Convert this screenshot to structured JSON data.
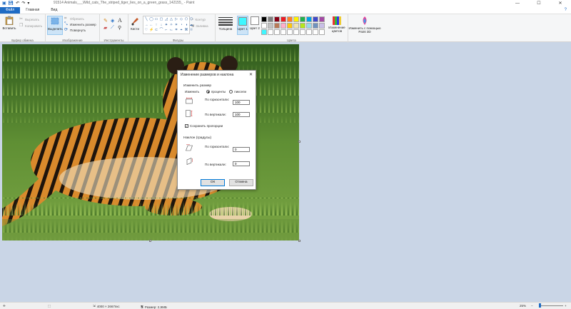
{
  "window": {
    "title": "91514 Animals___Wild_cats_The_striped_tiger_lies_on_a_green_grass_142155_ - Paint",
    "minimize": "—",
    "maximize": "☐",
    "close": "✕"
  },
  "quick_access": [
    "save-icon",
    "undo-icon",
    "redo-icon",
    "dropdown-icon"
  ],
  "tabs": [
    "Файл",
    "Главная",
    "Вид"
  ],
  "help_glyph": "?",
  "ribbon": {
    "clipboard": {
      "paste": "Вставить",
      "cut": "Вырезать",
      "copy": "Копировать",
      "label": "Буфер обмена"
    },
    "image": {
      "select": "Выделить",
      "crop": "Обрезать",
      "resize": "Изменить размер",
      "rotate": "Повернуть",
      "label": "Изображение"
    },
    "tools": {
      "label": "Инструменты",
      "text_tool": "A"
    },
    "brushes": {
      "label": "Кисти"
    },
    "shapes": {
      "glyphs": [
        "╲",
        "◯",
        "▭",
        "▢",
        "◿",
        "△",
        "▷",
        "◇",
        "⬠",
        "⬡",
        "→",
        "←",
        "↑",
        "↓",
        "✦",
        "✧",
        "✶",
        "◔",
        "◑",
        "☁",
        "♡",
        "⚡",
        "⊂",
        "⌒",
        "⌐",
        "⌙",
        "⌗",
        "⌖",
        "⌘",
        "⌑"
      ],
      "outline": "Контур",
      "fill": "Заливка",
      "label": "Фигуры"
    },
    "size": {
      "label": "Толщина"
    },
    "colors": {
      "color1_label": "Цвет 1",
      "color1": "#3ff6ff",
      "color2_label": "Цвет 2",
      "color2": "#ffffff",
      "palette": [
        "#000000",
        "#7f7f7f",
        "#880015",
        "#ed1c24",
        "#ff7f27",
        "#fff200",
        "#22b14c",
        "#00a2e8",
        "#3f48cc",
        "#a349a4",
        "#ffffff",
        "#c3c3c3",
        "#b97a57",
        "#ffaec9",
        "#ffc90e",
        "#efe4b0",
        "#b5e61d",
        "#99d9ea",
        "#7092be",
        "#c8bfe7",
        "#3ff6ff",
        "#ffffff",
        "#ffffff",
        "#ffffff",
        "#ffffff",
        "#ffffff",
        "#ffffff",
        "#ffffff",
        "#ffffff",
        "#ffffff"
      ],
      "edit": "Изменение цветов",
      "label": "Цвета"
    },
    "paint3d": {
      "label": "Изменить с помощью Paint 3D"
    }
  },
  "dialog": {
    "title": "Изменение размеров и наклона",
    "close": "✕",
    "resize_section": "Изменить размер",
    "by_label": "Изменить",
    "percent": "проценты",
    "pixels": "пиксели",
    "horizontal_label": "По горизонтали:",
    "horizontal_value": "100",
    "vertical_label": "По вертикали:",
    "vertical_value": "100",
    "keep_ratio": "Сохранить пропорции",
    "keep_ratio_checked": true,
    "skew_section": "Наклон (градусы)",
    "skew_h_label": "По горизонтали:",
    "skew_h_value": "0",
    "skew_v_label": "По вертикали:",
    "skew_v_value": "0",
    "ok": "ОК",
    "cancel": "Отмена"
  },
  "status": {
    "size_px": "4000 × 2667пкс",
    "file_size": "Размер: 2,9МБ",
    "zoom": "25%",
    "zoom_level": 0.25
  }
}
